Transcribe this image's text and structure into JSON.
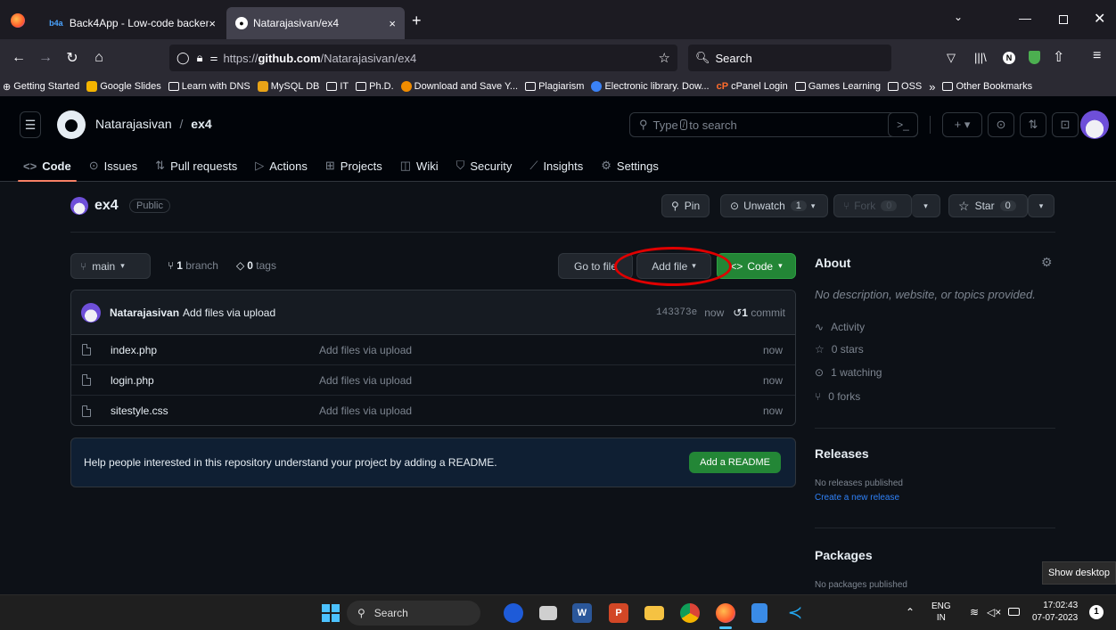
{
  "browser": {
    "tabs": [
      {
        "label": "Back4App - Low-code backend",
        "icon": "b4a-icon"
      },
      {
        "label": "Natarajasivan/ex4",
        "icon": "github-icon"
      }
    ],
    "close_glyph": "×",
    "new_tab_glyph": "+",
    "url_prefix": "https://",
    "url_host": "github.com",
    "url_path": "/Natarajasivan/ex4",
    "search_placeholder": "Search",
    "bookmarks": [
      "Getting Started",
      "Google Slides",
      "Learn with DNS",
      "MySQL DB",
      "IT",
      "Ph.D.",
      "Download and Save Y...",
      "Plagiarism",
      "Electronic library. Dow...",
      "cPanel Login",
      "Games Learning",
      "OSS"
    ],
    "bookmarks_more": "»",
    "other_bookmarks": "Other Bookmarks"
  },
  "github": {
    "owner": "Natarajasivan",
    "separator": "/",
    "repo": "ex4",
    "search_placeholder_a": "Type",
    "search_placeholder_key": "/",
    "search_placeholder_b": "to search",
    "tabs": [
      "Code",
      "Issues",
      "Pull requests",
      "Actions",
      "Projects",
      "Wiki",
      "Security",
      "Insights",
      "Settings"
    ],
    "visibility": "Public",
    "pin": "Pin",
    "unwatch": "Unwatch",
    "unwatch_count": "1",
    "fork": "Fork",
    "fork_count": "0",
    "star": "Star",
    "star_count": "0",
    "branch": "main",
    "branch_count": "1",
    "branch_label": "branch",
    "tag_count": "0",
    "tag_label": "tags",
    "go_to_file": "Go to file",
    "add_file": "Add file",
    "code": "Code",
    "commit": {
      "author": "Natarajasivan",
      "message": "Add files via upload",
      "sha": "143373e",
      "time": "now",
      "count": "1",
      "count_label": "commit"
    },
    "files": [
      {
        "name": "index.php",
        "message": "Add files via upload",
        "time": "now"
      },
      {
        "name": "login.php",
        "message": "Add files via upload",
        "time": "now"
      },
      {
        "name": "sitestyle.css",
        "message": "Add files via upload",
        "time": "now"
      }
    ],
    "readme_text": "Help people interested in this repository understand your project by adding a README.",
    "add_readme": "Add a README",
    "about": {
      "title": "About",
      "description": "No description, website, or topics provided.",
      "activity": "Activity",
      "stars": "0 stars",
      "watching": "1 watching",
      "forks": "0 forks"
    },
    "releases": {
      "title": "Releases",
      "none": "No releases published",
      "create": "Create a new release"
    },
    "packages": {
      "title": "Packages",
      "none": "No packages published"
    }
  },
  "tooltip": "Show desktop",
  "taskbar": {
    "search": "Search",
    "lang": "ENG",
    "region": "IN",
    "time": "17:02:43",
    "date": "07-07-2023",
    "notif": "1"
  },
  "colors": {
    "accent_green": "#238636",
    "annotation_red": "#e00000",
    "tab_underline": "#f78166"
  }
}
